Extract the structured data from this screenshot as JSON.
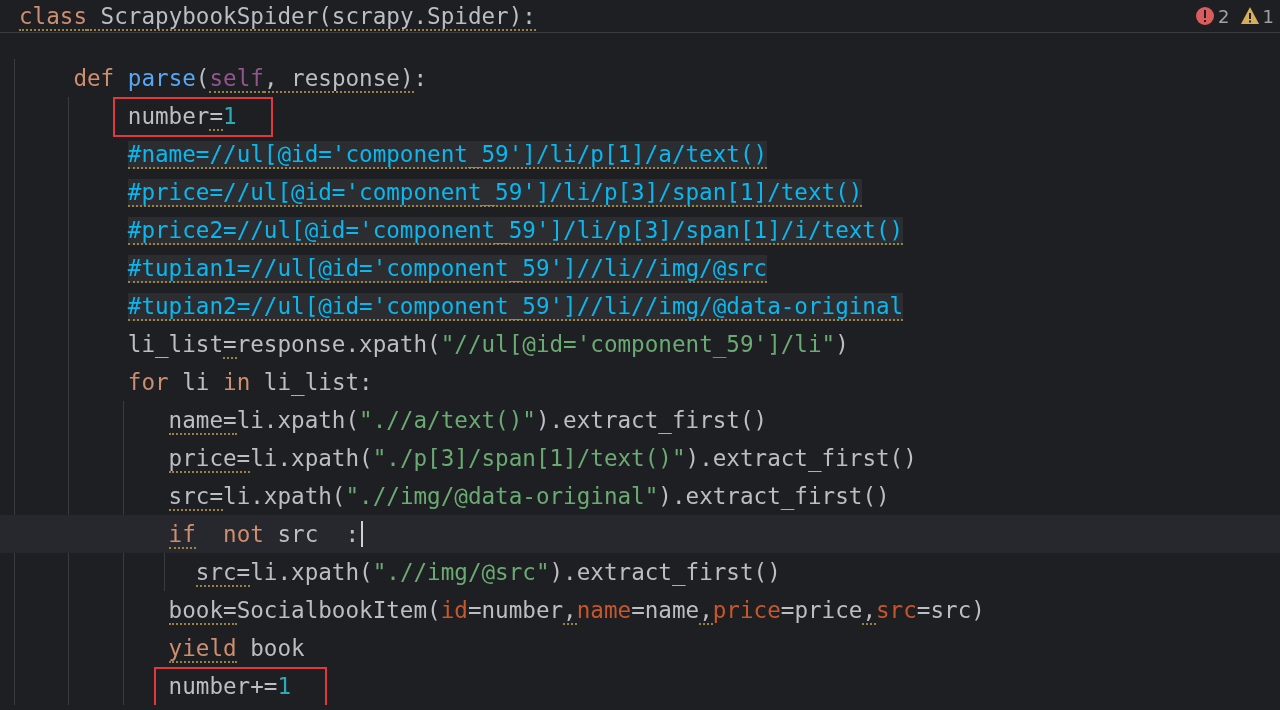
{
  "header": {
    "tokens": [
      {
        "text": "class",
        "kind": "keyword",
        "warn": true
      },
      {
        "text": " ScrapybookSpider(scrapy.Spider):",
        "kind": "plain",
        "warn": true
      }
    ],
    "problems": [
      {
        "kind": "error",
        "count": "2"
      },
      {
        "kind": "warning",
        "count": "1"
      }
    ]
  },
  "lines": [
    {
      "highlighted": false,
      "current": false,
      "boxed": false,
      "caret": false,
      "tokens": [
        {
          "text": "def",
          "kind": "keyword",
          "warn": false
        },
        {
          "text": " parse",
          "kind": "function",
          "warn": false
        },
        {
          "text": "(",
          "kind": "plain",
          "warn": false
        },
        {
          "text": "self",
          "kind": "self",
          "warn": true
        },
        {
          "text": ", response)",
          "kind": "plain",
          "warn": true
        },
        {
          "text": ":",
          "kind": "plain",
          "warn": false
        }
      ],
      "children": [
        {
          "highlighted": false,
          "current": false,
          "boxed": true,
          "caret": false,
          "tokens": [
            {
              "text": "number",
              "kind": "plain",
              "warn": false
            },
            {
              "text": "=",
              "kind": "plain",
              "warn": true
            },
            {
              "text": "1",
              "kind": "number",
              "warn": false
            }
          ]
        },
        {
          "highlighted": true,
          "current": false,
          "boxed": false,
          "caret": false,
          "tokens": [
            {
              "text": "#name=//ul[@id='component_59']/li/p[1]/a/text()",
              "kind": "comment",
              "warn": true
            }
          ]
        },
        {
          "highlighted": true,
          "current": false,
          "boxed": false,
          "caret": false,
          "tokens": [
            {
              "text": "#price=//ul[@id='component_59']/li/p[3]/span[1]/text()",
              "kind": "comment",
              "warn": true
            }
          ]
        },
        {
          "highlighted": true,
          "current": false,
          "boxed": false,
          "caret": false,
          "tokens": [
            {
              "text": "#price2=//ul[@id='component_59']/li/p[3]/span[1]/i/text()",
              "kind": "comment",
              "warn": true
            }
          ]
        },
        {
          "highlighted": true,
          "current": false,
          "boxed": false,
          "caret": false,
          "tokens": [
            {
              "text": "#tupian1=//ul[@id='component_59']//li//img/@src",
              "kind": "comment",
              "warn": true
            }
          ]
        },
        {
          "highlighted": true,
          "current": false,
          "boxed": false,
          "caret": false,
          "tokens": [
            {
              "text": "#tupian2=//ul[@id='component_59']//li//img/@data-original",
              "kind": "comment",
              "warn": true
            }
          ]
        },
        {
          "highlighted": false,
          "current": false,
          "boxed": false,
          "caret": false,
          "tokens": [
            {
              "text": "li_list",
              "kind": "plain",
              "warn": false
            },
            {
              "text": "=",
              "kind": "plain",
              "warn": true
            },
            {
              "text": "response.xpath(",
              "kind": "plain",
              "warn": false
            },
            {
              "text": "\"//ul[@id='component_59']/li\"",
              "kind": "string",
              "warn": false
            },
            {
              "text": ")",
              "kind": "plain",
              "warn": false
            }
          ]
        },
        {
          "highlighted": false,
          "current": false,
          "boxed": false,
          "caret": false,
          "tokens": [
            {
              "text": "for",
              "kind": "keyword",
              "warn": false
            },
            {
              "text": " li ",
              "kind": "plain",
              "warn": false
            },
            {
              "text": "in",
              "kind": "keyword",
              "warn": false
            },
            {
              "text": " li_list:",
              "kind": "plain",
              "warn": false
            }
          ],
          "children": [
            {
              "highlighted": false,
              "current": false,
              "boxed": false,
              "caret": false,
              "tokens": [
                {
                  "text": "name=",
                  "kind": "plain",
                  "warn": true
                },
                {
                  "text": "li.xpath(",
                  "kind": "plain",
                  "warn": false
                },
                {
                  "text": "\".//a/text()\"",
                  "kind": "string",
                  "warn": false
                },
                {
                  "text": ").extract_first()",
                  "kind": "plain",
                  "warn": false
                }
              ]
            },
            {
              "highlighted": false,
              "current": false,
              "boxed": false,
              "caret": false,
              "tokens": [
                {
                  "text": "price=",
                  "kind": "plain",
                  "warn": true
                },
                {
                  "text": "li.xpath(",
                  "kind": "plain",
                  "warn": false
                },
                {
                  "text": "\"./p[3]/span[1]/text()\"",
                  "kind": "string",
                  "warn": false
                },
                {
                  "text": ").extract_first()",
                  "kind": "plain",
                  "warn": false
                }
              ]
            },
            {
              "highlighted": false,
              "current": false,
              "boxed": false,
              "caret": false,
              "tokens": [
                {
                  "text": "src=",
                  "kind": "plain",
                  "warn": true
                },
                {
                  "text": "li.xpath(",
                  "kind": "plain",
                  "warn": false
                },
                {
                  "text": "\".//img/@data-original\"",
                  "kind": "string",
                  "warn": false
                },
                {
                  "text": ").extract_first()",
                  "kind": "plain",
                  "warn": false
                }
              ]
            },
            {
              "highlighted": false,
              "current": true,
              "boxed": false,
              "caret": true,
              "tokens": [
                {
                  "text": "if",
                  "kind": "keyword",
                  "warn": true
                },
                {
                  "text": "  not",
                  "kind": "keyword",
                  "warn": false
                },
                {
                  "text": " src",
                  "kind": "plain",
                  "warn": false
                },
                {
                  "text": "  :",
                  "kind": "plain",
                  "warn": false
                }
              ],
              "children": [
                {
                  "highlighted": false,
                  "current": false,
                  "boxed": false,
                  "caret": false,
                  "tokens": [
                    {
                      "text": "src=",
                      "kind": "plain",
                      "warn": true
                    },
                    {
                      "text": "li.xpath(",
                      "kind": "plain",
                      "warn": false
                    },
                    {
                      "text": "\".//img/@src\"",
                      "kind": "string",
                      "warn": false
                    },
                    {
                      "text": ").extract_first()",
                      "kind": "plain",
                      "warn": false
                    }
                  ]
                }
              ]
            },
            {
              "highlighted": false,
              "current": false,
              "boxed": false,
              "caret": false,
              "tokens": [
                {
                  "text": "book=",
                  "kind": "plain",
                  "warn": true
                },
                {
                  "text": "SocialbookItem(",
                  "kind": "plain",
                  "warn": false
                },
                {
                  "text": "id",
                  "kind": "param",
                  "warn": false
                },
                {
                  "text": "=number",
                  "kind": "plain",
                  "warn": false
                },
                {
                  "text": ",",
                  "kind": "plain",
                  "warn": true
                },
                {
                  "text": "name",
                  "kind": "param",
                  "warn": false
                },
                {
                  "text": "=name",
                  "kind": "plain",
                  "warn": false
                },
                {
                  "text": ",",
                  "kind": "plain",
                  "warn": true
                },
                {
                  "text": "price",
                  "kind": "param",
                  "warn": false
                },
                {
                  "text": "=price",
                  "kind": "plain",
                  "warn": false
                },
                {
                  "text": ",",
                  "kind": "plain",
                  "warn": true
                },
                {
                  "text": "src",
                  "kind": "param",
                  "warn": false
                },
                {
                  "text": "=src)",
                  "kind": "plain",
                  "warn": false
                }
              ]
            },
            {
              "highlighted": false,
              "current": false,
              "boxed": false,
              "caret": false,
              "tokens": [
                {
                  "text": "yield",
                  "kind": "keyword",
                  "warn": true
                },
                {
                  "text": " book",
                  "kind": "plain",
                  "warn": false
                }
              ]
            },
            {
              "highlighted": false,
              "current": false,
              "boxed": true,
              "caret": false,
              "tokens": [
                {
                  "text": "number+=",
                  "kind": "plain",
                  "warn": false
                },
                {
                  "text": "1",
                  "kind": "number",
                  "warn": false
                }
              ]
            }
          ]
        }
      ]
    }
  ]
}
